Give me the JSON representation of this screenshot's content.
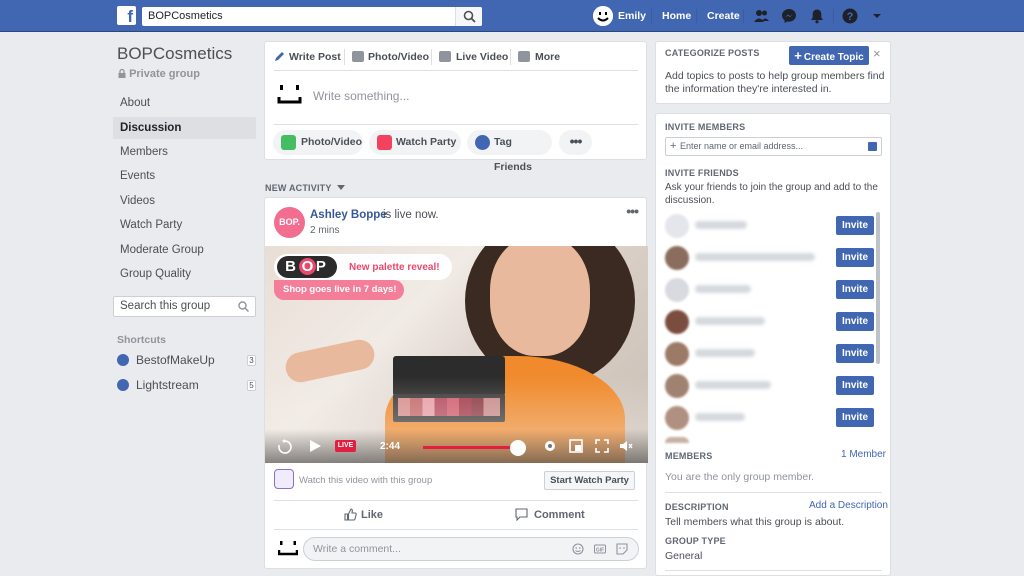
{
  "topbar": {
    "search_value": "BOPCosmetics",
    "user_name": "Emily",
    "home": "Home",
    "create": "Create"
  },
  "group": {
    "name": "BOPCosmetics",
    "privacy": "Private group"
  },
  "nav": [
    {
      "label": "About"
    },
    {
      "label": "Discussion",
      "active": true
    },
    {
      "label": "Members"
    },
    {
      "label": "Events"
    },
    {
      "label": "Videos"
    },
    {
      "label": "Watch Party"
    },
    {
      "label": "Moderate Group"
    },
    {
      "label": "Group Quality"
    }
  ],
  "left_search_placeholder": "Search this group",
  "shortcuts": {
    "heading": "Shortcuts",
    "items": [
      {
        "label": "BestofMakeUp",
        "count": "3"
      },
      {
        "label": "Lightstream",
        "count": "5"
      }
    ]
  },
  "composer": {
    "tabs": [
      "Write Post",
      "Photo/Video",
      "Live Video",
      "More"
    ],
    "placeholder": "Write something...",
    "pills": [
      "Photo/Video",
      "Watch Party",
      "Tag Friends"
    ]
  },
  "feed_heading": "NEW ACTIVITY",
  "post": {
    "author": "Ashley Boppe",
    "status": "is live now.",
    "time": "2 mins",
    "avatar_text": "BOP.",
    "video": {
      "brand": "BOP",
      "reveal": "New palette reveal!",
      "shop": "Shop goes live in 7 days!",
      "live": "LIVE",
      "time": "2:44",
      "progress": 0.68
    },
    "watch_text": "Watch this video with this group",
    "watch_button": "Start Watch Party",
    "like": "Like",
    "comment": "Comment",
    "comment_placeholder": "Write a comment..."
  },
  "right": {
    "categorize": {
      "heading": "CATEGORIZE POSTS",
      "button": "Create Topic",
      "text": "Add topics to posts to help group members find the information they're interested in."
    },
    "invite": {
      "heading": "INVITE MEMBERS",
      "placeholder": "Enter name or email address...",
      "friends_heading": "INVITE FRIENDS",
      "friends_text": "Ask your friends to join the group and add to the discussion.",
      "button": "Invite",
      "friends": [
        {
          "avatar_color": "#e4e6eb",
          "name_width": 52
        },
        {
          "avatar_color": "#8a6d5c",
          "name_width": 120
        },
        {
          "avatar_color": "#d8dadf",
          "name_width": 56
        },
        {
          "avatar_color": "#7a4d3e",
          "name_width": 70
        },
        {
          "avatar_color": "#9b7a66",
          "name_width": 60
        },
        {
          "avatar_color": "#a08270",
          "name_width": 76
        },
        {
          "avatar_color": "#b09080",
          "name_width": 50
        }
      ]
    },
    "members": {
      "heading": "MEMBERS",
      "count": "1 Member",
      "text": "You are the only group member."
    },
    "description": {
      "heading": "DESCRIPTION",
      "link": "Add a Description",
      "text": "Tell members what this group is about."
    },
    "group_type": {
      "heading": "GROUP TYPE",
      "value": "General"
    }
  },
  "colors": {
    "brand": "#4267b2",
    "live": "#e41e3f",
    "bop_pink": "#e84a6e"
  }
}
